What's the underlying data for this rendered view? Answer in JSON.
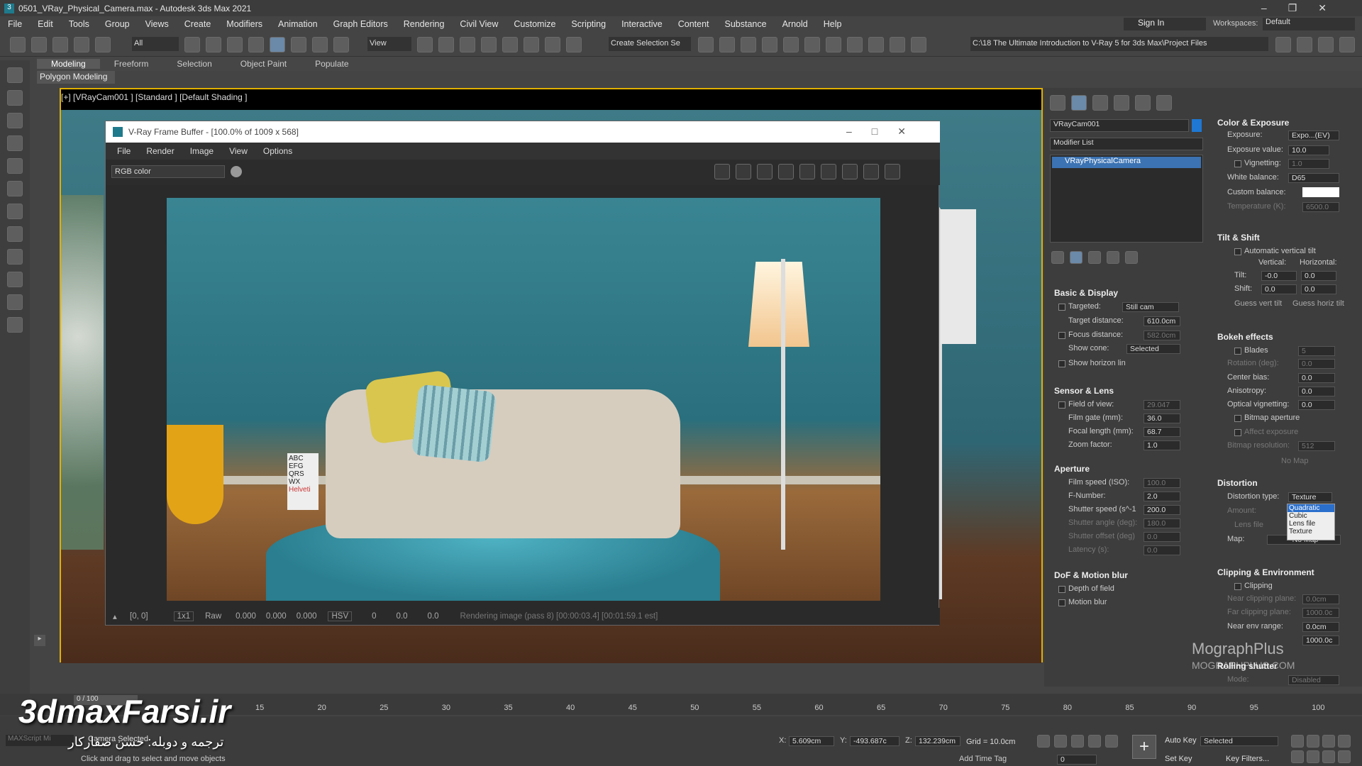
{
  "app": {
    "title": "0501_VRay_Physical_Camera.max - Autodesk 3ds Max 2021"
  },
  "menu": [
    "File",
    "Edit",
    "Tools",
    "Group",
    "Views",
    "Create",
    "Modifiers",
    "Animation",
    "Graph Editors",
    "Rendering",
    "Civil View",
    "Customize",
    "Scripting",
    "Interactive",
    "Content",
    "Substance",
    "Arnold",
    "Help"
  ],
  "account": {
    "sign_in": "Sign In",
    "workspaces_label": "Workspaces:",
    "workspace": "Default"
  },
  "toolbar": {
    "filter": "All",
    "view": "View",
    "selection_set": "Create Selection Se",
    "path": "C:\\18 The Ultimate Introduction to V-Ray 5 for 3ds Max\\Project Files"
  },
  "ribbon": {
    "tabs": [
      "Modeling",
      "Freeform",
      "Selection",
      "Object Paint",
      "Populate"
    ],
    "sub": "Polygon Modeling"
  },
  "viewport": {
    "label": "[+] [VRayCam001 ] [Standard ] [Default Shading ]"
  },
  "vfb": {
    "title": "V-Ray Frame Buffer - [100.0% of 1009 x 568]",
    "menu": [
      "File",
      "Render",
      "Image",
      "View",
      "Options"
    ],
    "channel": "RGB color",
    "coords": "[0, 0]",
    "ratio": "1x1",
    "raw": "Raw",
    "v1": "0.000",
    "v2": "0.000",
    "v3": "0.000",
    "color_mode": "HSV",
    "h": "0",
    "s": "0.0",
    "v": "0.0",
    "status": "Rendering image (pass 8) [00:00:03.4] [00:01:59.1 est]",
    "poster_text": "Helveti"
  },
  "panel": {
    "object_name": "VRayCam001",
    "modifier_list": "Modifier List",
    "stack_item": "VRayPhysicalCamera",
    "basic": {
      "title": "Basic & Display",
      "targeted_label": "Targeted:",
      "targeted": "Still cam",
      "target_distance_label": "Target distance:",
      "target_distance": "610.0cm",
      "focus_label": "Focus distance:",
      "focus": "582.0cm",
      "cone_label": "Show cone:",
      "cone": "Selected",
      "horizon": "Show horizon lin"
    },
    "sensor": {
      "title": "Sensor & Lens",
      "fov_label": "Field of view:",
      "fov": "29.047",
      "film_label": "Film gate (mm):",
      "film": "36.0",
      "focal_label": "Focal length (mm):",
      "focal": "68.7",
      "zoom_label": "Zoom factor:",
      "zoom": "1.0"
    },
    "aperture": {
      "title": "Aperture",
      "iso_label": "Film speed (ISO):",
      "iso": "100.0",
      "f_label": "F-Number:",
      "f": "2.0",
      "shutter_label": "Shutter speed (s^-1",
      "shutter": "200.0",
      "angle_label": "Shutter angle (deg):",
      "angle": "180.0",
      "offset_label": "Shutter offset (deg)",
      "offset": "0.0",
      "latency_label": "Latency (s):",
      "latency": "0.0"
    },
    "dof": {
      "title": "DoF & Motion blur",
      "dof": "Depth of field",
      "mb": "Motion blur"
    },
    "color": {
      "title": "Color & Exposure",
      "exposure_label": "Exposure:",
      "exposure": "Expo...(EV)",
      "ev_label": "Exposure value:",
      "ev": "10.0",
      "vignetting": "Vignetting:",
      "vig": "1.0",
      "wb_label": "White balance:",
      "wb": "D65",
      "cb_label": "Custom balance:",
      "temp_label": "Temperature (K):",
      "temp": "6500.0"
    },
    "tilt": {
      "title": "Tilt & Shift",
      "auto": "Automatic vertical tilt",
      "vertical": "Vertical:",
      "horizontal": "Horizontal:",
      "tilt_label": "Tilt:",
      "tilt_v": "-0.0",
      "tilt_h": "0.0",
      "shift_label": "Shift:",
      "shift_v": "0.0",
      "shift_h": "0.0",
      "guess_v": "Guess vert tilt",
      "guess_h": "Guess horiz tilt"
    },
    "bokeh": {
      "title": "Bokeh effects",
      "blades": "Blades",
      "blades_v": "5",
      "rotation_label": "Rotation (deg):",
      "rotation": "0.0",
      "center_label": "Center bias:",
      "center": "0.0",
      "aniso_label": "Anisotropy:",
      "aniso": "0.0",
      "optical_label": "Optical vignetting:",
      "optical": "0.0",
      "bitmap": "Bitmap aperture",
      "affect": "Affect exposure",
      "bres_label": "Bitmap resolution:",
      "bres": "512",
      "nomap": "No Map"
    },
    "distortion": {
      "title": "Distortion",
      "type_label": "Distortion type:",
      "type": "Texture",
      "amount_label": "Amount:",
      "lens_label": "Lens file",
      "map_label": "Map:",
      "map": "No Map",
      "options": [
        "Quadratic",
        "Cubic",
        "Lens file",
        "Texture"
      ]
    },
    "clipping": {
      "title": "Clipping & Environment",
      "clipping": "Clipping",
      "near_label": "Near clipping plane:",
      "near": "0.0cm",
      "far_label": "Far clipping plane:",
      "far": "1000.0c",
      "near_env_label": "Near env range:",
      "near_env": "0.0cm",
      "far_env": "1000.0c"
    },
    "rolling": {
      "title": "Rolling shutter",
      "mode_label": "Mode:",
      "mode": "Disabled"
    }
  },
  "timeline": {
    "frame": "0 / 100",
    "ticks": [
      "15",
      "20",
      "25",
      "30",
      "35",
      "40",
      "45",
      "50",
      "55",
      "60",
      "65",
      "70",
      "75",
      "80",
      "85",
      "90",
      "95",
      "100"
    ]
  },
  "status": {
    "selected": "Camera Selected",
    "hint": "Click and drag to select and move objects",
    "x": "5.609cm",
    "y": "-493.687c",
    "z": "132.239cm",
    "grid": "Grid = 10.0cm",
    "add_time_tag": "Add Time Tag",
    "auto_key": "Auto Key",
    "set_key": "Set Key",
    "key_mode": "Selected",
    "key_filters": "Key Filters...",
    "frame": "0",
    "maxscript": "MAXScript Mi"
  },
  "watermark": {
    "site": "3dmaxFarsi.ir",
    "brand": "MographPlus",
    "brand_url": "MOGRAPHPLUS.COM",
    "credit": "ترجمه و دوبله: حسن صفارکار"
  }
}
